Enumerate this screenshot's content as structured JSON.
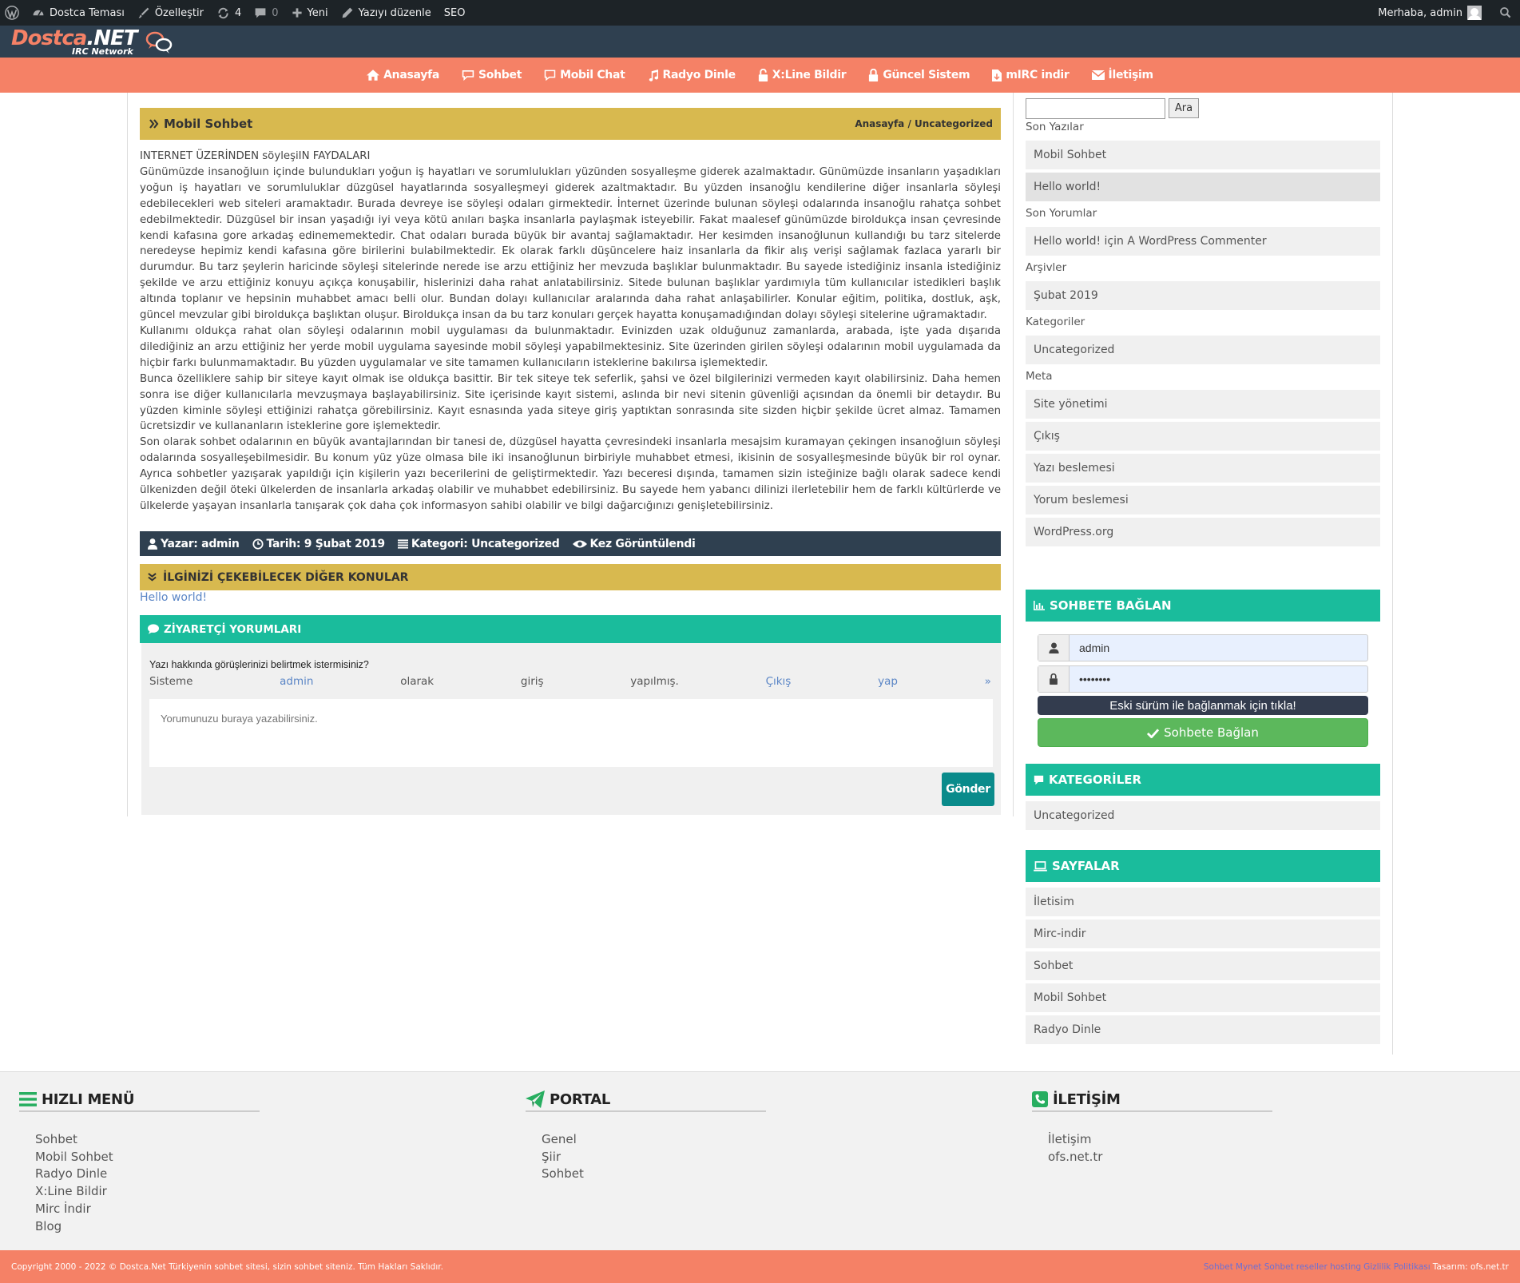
{
  "adminbar": {
    "site_name": "Dostca Teması",
    "customize": "Özelleştir",
    "updates_count": "4",
    "comments_count": "0",
    "new_label": "Yeni",
    "edit_post": "Yazıyı düzenle",
    "seo": "SEO",
    "greeting": "Merhaba, admin"
  },
  "logo": {
    "part1": "Dostca",
    "part2": ".NET",
    "subtitle": "IRC Network"
  },
  "nav": [
    {
      "label": "Anasayfa",
      "icon": "home-icon"
    },
    {
      "label": "Sohbet",
      "icon": "comment-outline-icon"
    },
    {
      "label": "Mobil Chat",
      "icon": "chat-bubble-icon"
    },
    {
      "label": "Radyo Dinle",
      "icon": "music-icon"
    },
    {
      "label": "X:Line Bildir",
      "icon": "unlock-icon"
    },
    {
      "label": "Güncel Sistem",
      "icon": "lock-icon"
    },
    {
      "label": "mIRC indir",
      "icon": "file-icon"
    },
    {
      "label": "İletişim",
      "icon": "envelope-icon"
    }
  ],
  "post": {
    "title": "Mobil Sohbet",
    "breadcrumb_home": "Anasayfa",
    "breadcrumb_sep": "/",
    "breadcrumb_cat": "Uncategorized",
    "heading": "INTERNET ÜZERİNDEN söyleşiIN FAYDALARI",
    "paragraphs": [
      "Günümüzde insanoğluın içinde bulundukları yoğun iş hayatları ve sorumlulukları yüzünden sosyalleşme giderek azalmaktadır. Günümüzde insanların yaşadıkları yoğun iş hayatları ve sorumluluklar düzgüsel hayatlarında sosyalleşmeyi giderek azaltmaktadır. Bu yüzden insanoğlu kendilerine diğer insanlarla söyleşi edebilecekleri web siteleri aramaktadır. Burada devreye ise söyleşi odaları girmektedir. İnternet üzerinde bulunan söyleşi odalarında insanoğlu rahatça sohbet edebilmektedir. Düzgüsel bir insan yaşadığı iyi veya kötü anıları başka insanlarla paylaşmak isteyebilir. Fakat maalesef günümüzde biroldukça insan çevresinde kendi kafasına gore arkadaş edinememektedir. Chat odaları burada büyük bir avantaj sağlamaktadır. Her kesimden insanoğlunun kullandığı bu tarz sitelerde neredeyse hepimiz kendi kafasına göre birilerini bulabilmektedir. Ek olarak farklı düşüncelere haiz insanlarla da fikir alış verişi sağlamak fazlaca yararlı bir durumdur. Bu tarz şeylerin haricinde söyleşi sitelerinde nerede ise arzu ettiğiniz her mevzuda başlıklar bulunmaktadır. Bu sayede istediğiniz insanla istediğiniz şekilde ve arzu ettiğiniz konuyu açıkça konuşabilir, hislerinizi daha rahat anlatabilirsiniz. Sitede bulunan başlıklar yardımıyla tüm kullanıcılar istedikleri başlık altında toplanır ve hepsinin muhabbet amacı belli olur. Bundan dolayı kullanıcılar aralarında daha rahat anlaşabilirler. Konular eğitim, politika, dostluk, aşk, güncel mevzular gibi biroldukça başlıktan oluşur. Biroldukça insan da bu tarz konuları gerçek hayatta konuşamadığından dolayı söyleşi sitelerine uğramaktadır.",
      "Kullanımı oldukça rahat olan söyleşi odalarının mobil uygulaması da bulunmaktadır. Evinizden uzak olduğunuz zamanlarda, arabada, işte yada dışarıda dilediğiniz an arzu ettiğiniz her yerde mobil uygulama sayesinde mobil söyleşi yapabilmektesiniz. Site üzerinden girilen söyleşi odalarının mobil uygulamada da hiçbir farkı bulunmamaktadır. Bu yüzden uygulamalar ve site tamamen kullanıcıların isteklerine bakılırsa işlemektedir.",
      "Bunca özelliklere sahip bir siteye kayıt olmak ise oldukça basittir. Bir tek siteye tek seferlik, şahsi ve özel bilgilerinizi vermeden kayıt olabilirsiniz. Daha hemen sonra ise diğer kullanıcılarla mevzuşmaya başlayabilirsiniz. Site içerisinde kayıt sistemi, aslında bir nevi sitenin güvenliği açısından da önemli bir detaydır. Bu yüzden kiminle söyleşi ettiğinizi rahatça görebilirsiniz. Kayıt esnasında yada siteye giriş yaptıktan sonrasında site sizden hiçbir şekilde ücret almaz. Tamamen ücretsizdir ve kullananların isteklerine gore işlemektedir.",
      "Son olarak sohbet odalarının en büyük avantajlarından bir tanesi de, düzgüsel hayatta çevresindeki insanlarla mesajsim kuramayan çekingen insanoğluın söyleşi odalarında sosyalleşebilmesidir. Bu konum yüz yüze olmasa bile iki insanoğlunun birbiriyle muhabbet etmesi, ikisinin de sosyalleşmesinde büyük bir rol oynar. Ayrıca sohbetler yazışarak yapıldığı için kişilerin yazı becerilerini de geliştirmektedir. Yazı beceresi dışında, tamamen sizin isteğinize bağlı olarak sadece kendi ülkenizden değil öteki ülkelerden de insanlarla arkadaş olabilir ve muhabbet edebilirsiniz. Bu sayede hem yabancı dilinizi ilerletebilir hem de farklı kültürlerde ve ülkelerde yaşayan insanlarla tanışarak çok daha çok informasyon sahibi olabilir ve bilgi dağarcığınızı genişletebilirsiniz."
    ],
    "meta": {
      "author": "Yazar: admin",
      "date": "Tarih: 9 Şubat 2019",
      "category": "Kategori: Uncategorized",
      "views": "Kez Görüntülendi"
    },
    "related_title": "İLGİNİZİ ÇEKEBİLECEK DİĞER KONULAR",
    "related_link": "Hello world!"
  },
  "comments": {
    "title": "ZİYARETÇİ YORUMLARI",
    "question": "Yazı hakkında görüşlerinizi belirtmek istermisiniz?",
    "login_words": [
      "Sisteme",
      "admin",
      "olarak",
      "giriş",
      "yapılmış.",
      "Çıkış",
      "yap",
      "»"
    ],
    "placeholder": "Yorumunuzu buraya yazabilirsiniz.",
    "send": "Gönder"
  },
  "sidebar": {
    "search_button": "Ara",
    "recent_posts_title": "Son Yazılar",
    "recent_posts": [
      "Mobil Sohbet",
      "Hello world!"
    ],
    "recent_comments_title": "Son Yorumlar",
    "recent_comments": [
      "Hello world! için A WordPress Commenter"
    ],
    "archives_title": "Arşivler",
    "archives": [
      "Şubat 2019"
    ],
    "categories_title": "Kategoriler",
    "categories": [
      "Uncategorized"
    ],
    "meta_title": "Meta",
    "meta": [
      "Site yönetimi",
      "Çıkış",
      "Yazı beslemesi",
      "Yorum beslemesi",
      "WordPress.org"
    ],
    "chat_widget_title": "SOHBETE BAĞLAN",
    "nick_value": "admin",
    "password_value": "••••••••",
    "old_version_link": "Eski sürüm ile bağlanmak için tıkla!",
    "connect_button": "Sohbete Bağlan",
    "kategoriler_widget_title": "KATEGORİLER",
    "kategoriler_items": [
      "Uncategorized"
    ],
    "sayfalar_widget_title": "SAYFALAR",
    "sayfalar_items": [
      "İletisim",
      "Mirc-indir",
      "Sohbet",
      "Mobil Sohbet",
      "Radyo Dinle"
    ]
  },
  "footer": {
    "col1_title": "HIZLI MENÜ",
    "col1_items": [
      "Sohbet",
      "Mobil Sohbet",
      "Radyo Dinle",
      "X:Line Bildir",
      "Mirc İndir",
      "Blog"
    ],
    "col2_title": "PORTAL",
    "col2_items": [
      "Genel",
      "Şiir",
      "Sohbet"
    ],
    "col3_title": "İLETİŞİM",
    "col3_items": [
      "İletişim",
      "ofs.net.tr"
    ],
    "copyright": "Copyright 2000 - 2022 © Dostca.Net Türkiyenin sohbet sitesi, sizin sohbet siteniz. Tüm Hakları Saklıdır.",
    "bottom_links": [
      "Sohbet",
      "Mynet Sohbet",
      "reseller hosting",
      "Gizlilik Politikası"
    ],
    "design_credit": "Tasarım: ofs.net.tr"
  },
  "colors": {
    "accent_orange": "#f58166",
    "dark_blue": "#2f4050",
    "gold": "#d8b94f",
    "teal": "#1abc9c",
    "green_button": "#5cb85c"
  }
}
